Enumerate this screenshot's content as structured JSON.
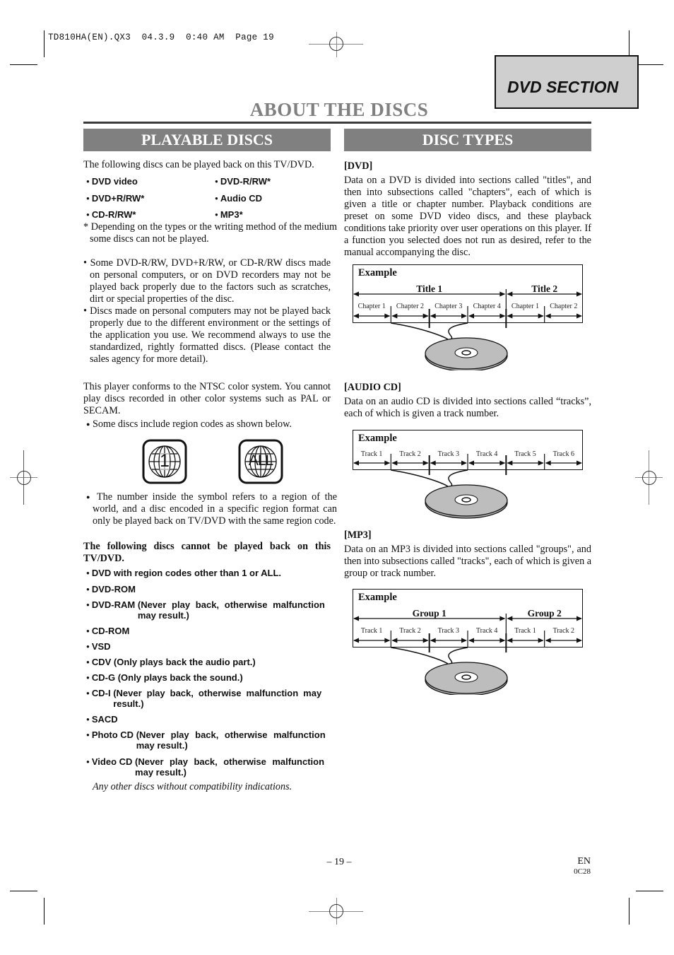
{
  "print_header": {
    "file_name": "TD810HA(EN).QX3",
    "date": "04.3.9",
    "time": "0:40 AM",
    "page_label": "Page 19"
  },
  "section_tab": "DVD SECTION",
  "page_title": "ABOUT THE DISCS",
  "playable_discs": {
    "heading": "PLAYABLE DISCS",
    "intro": "The following discs can be played back on this TV/DVD.",
    "disc_list": [
      "DVD video",
      "DVD-R/RW*",
      "DVD+R/RW*",
      "Audio CD",
      "CD-R/RW*",
      "MP3*"
    ],
    "footnote": "* Depending on the types or the writing method of the medium some discs can not be played.",
    "notes": [
      "Some DVD-R/RW, DVD+R/RW, or CD-R/RW discs made on personal computers, or on DVD recorders may not be played back properly due to the factors such as scratches, dirt or special properties of the disc.",
      "Discs made on personal computers may not be played back properly due to the different environment or the settings of the application you use. We recommend always to use the standardized, rightly formatted discs. (Please contact the sales agency for more detail)."
    ],
    "ntsc_text": "This player conforms to the NTSC color system. You cannot play discs recorded in other color systems such as PAL or SECAM.",
    "region_intro": "Some discs include region codes as shown below.",
    "region_icons": [
      {
        "icon": "globe-region-icon",
        "label": "1"
      },
      {
        "icon": "globe-region-icon",
        "label": "ALL"
      }
    ],
    "region_explanation": "The number inside the symbol refers to a region of the world, and a disc encoded in a specific region format can only be played back on TV/DVD with the same region code.",
    "cannot_play_heading": "The following discs cannot be played back on this TV/DVD.",
    "cannot_play_list": [
      {
        "name": "DVD with region codes other than 1 or ALL.",
        "note": ""
      },
      {
        "name": "DVD-ROM",
        "note": ""
      },
      {
        "name": "DVD-RAM",
        "note": "(Never play back, otherwise malfunction may result.)"
      },
      {
        "name": "CD-ROM",
        "note": ""
      },
      {
        "name": "VSD",
        "note": ""
      },
      {
        "name": "CDV",
        "note": "(Only plays back the audio part.)"
      },
      {
        "name": "CD-G",
        "note": "(Only plays back the sound.)"
      },
      {
        "name": "CD-I",
        "note": "(Never play back, otherwise malfunction may result.)"
      },
      {
        "name": "SACD",
        "note": ""
      },
      {
        "name": "Photo CD",
        "note": "(Never play back, otherwise malfunction may result.)"
      },
      {
        "name": "Video CD",
        "note": "(Never play back, otherwise malfunction may result.)"
      }
    ],
    "closing_note": "Any other discs without compatibility indications."
  },
  "disc_types": {
    "heading": "DISC TYPES",
    "dvd": {
      "label": "[DVD]",
      "text": "Data on a DVD is divided into sections called \"titles\", and then into subsections called \"chapters\", each of which is given a title or chapter number. Playback conditions are preset on some DVD video discs, and these playback conditions take priority over user operations on this player. If a function you selected does not run as desired, refer to the manual accompanying the disc.",
      "example_label": "Example",
      "groups": [
        {
          "label": "Title 1",
          "segments": [
            "Chapter 1",
            "Chapter 2",
            "Chapter 3",
            "Chapter 4"
          ]
        },
        {
          "label": "Title 2",
          "segments": [
            "Chapter 1",
            "Chapter 2"
          ]
        }
      ]
    },
    "audio_cd": {
      "label": "[AUDIO CD]",
      "text": "Data on an audio CD is divided into sections called “tracks”, each of which is given a track number.",
      "example_label": "Example",
      "segments": [
        "Track 1",
        "Track 2",
        "Track 3",
        "Track 4",
        "Track 5",
        "Track 6"
      ]
    },
    "mp3": {
      "label": "[MP3]",
      "text": "Data on an MP3 is divided into sections called \"groups\", and then into subsections called \"tracks\", each of which is given a group or track number.",
      "example_label": "Example",
      "groups": [
        {
          "label": "Group 1",
          "segments": [
            "Track 1",
            "Track 2",
            "Track 3",
            "Track 4"
          ]
        },
        {
          "label": "Group 2",
          "segments": [
            "Track 1",
            "Track 2"
          ]
        }
      ]
    }
  },
  "footer": {
    "page_number": "– 19 –",
    "lang": "EN",
    "code": "0C28"
  }
}
